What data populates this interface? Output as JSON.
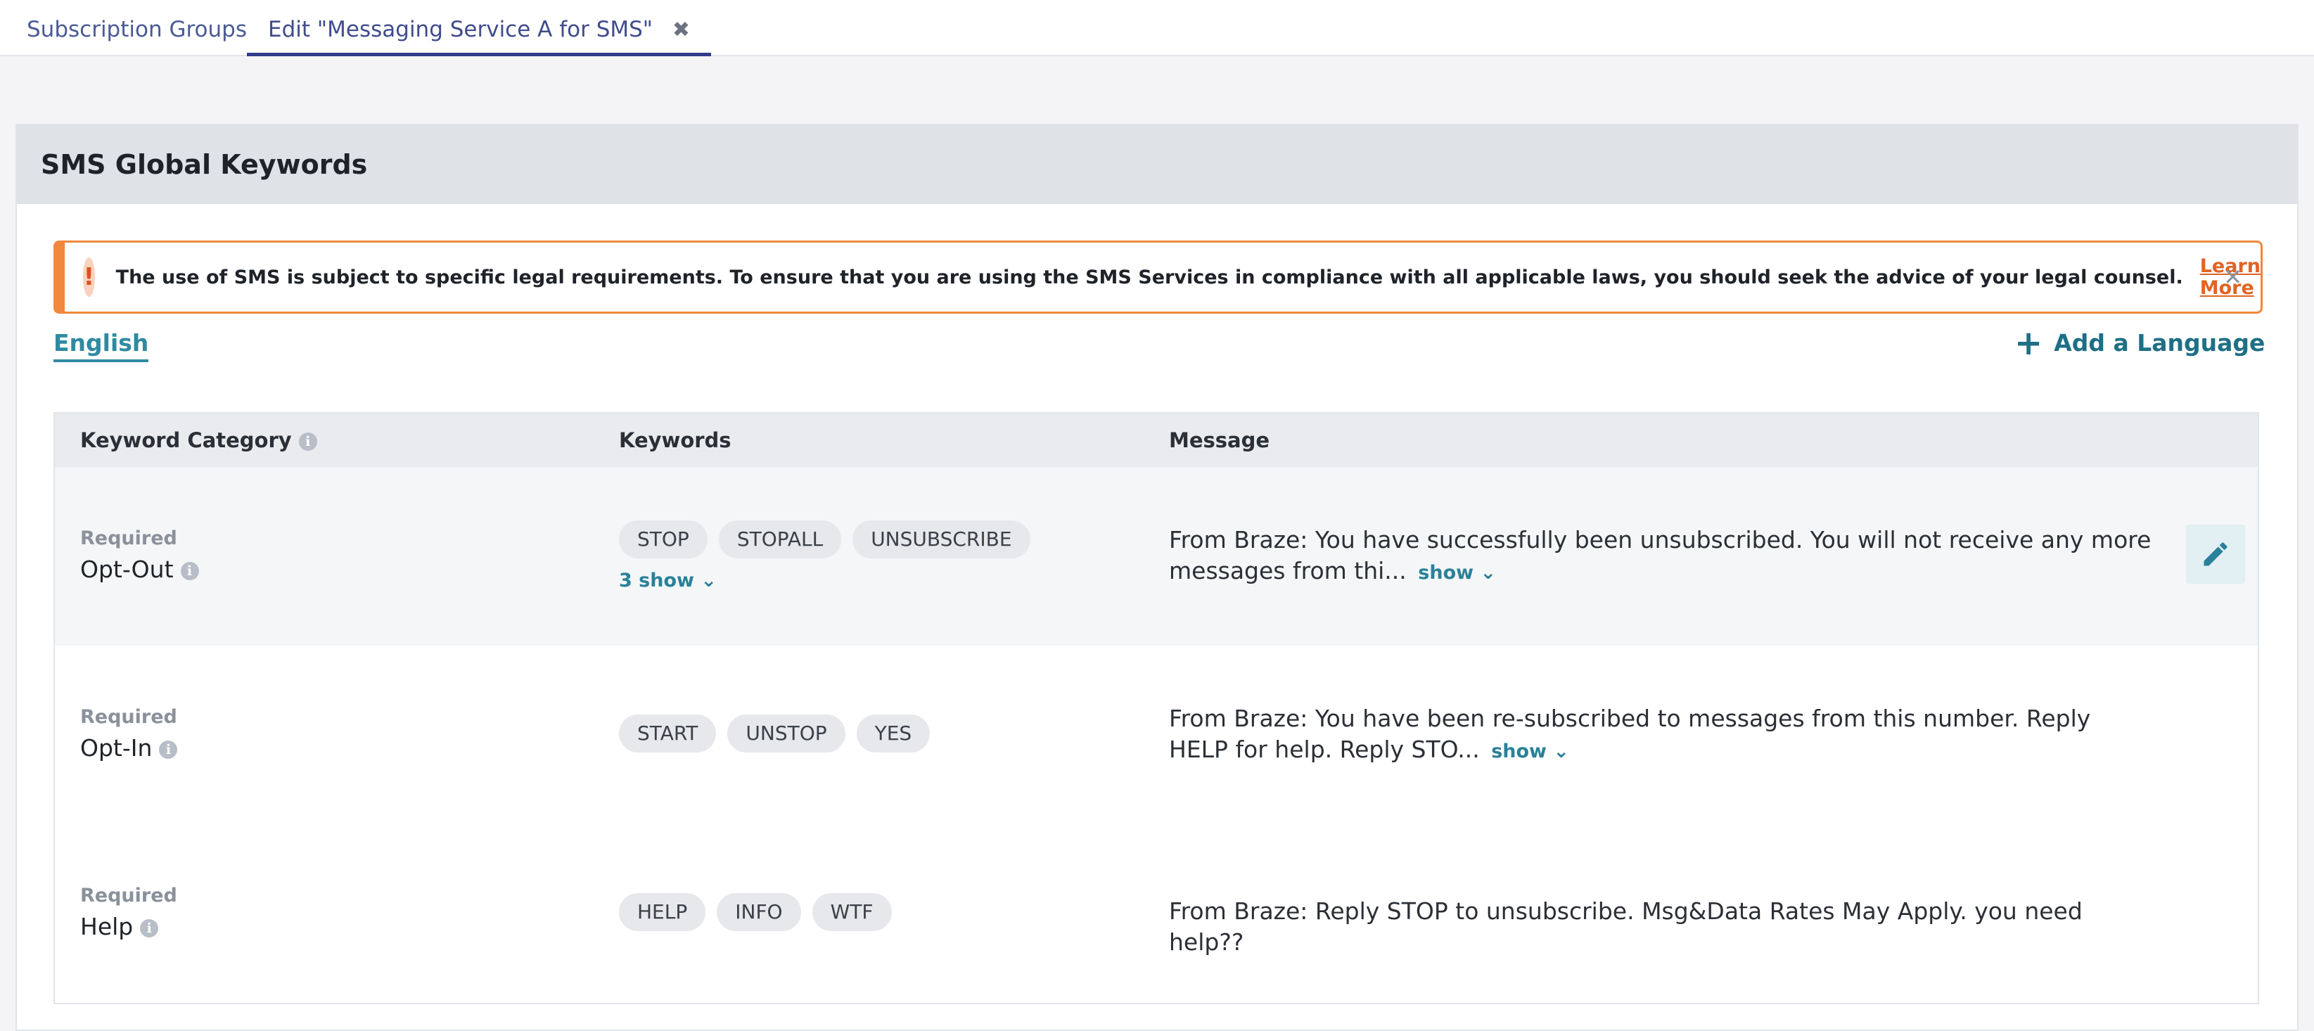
{
  "tabs": [
    {
      "label": "Subscription Groups"
    },
    {
      "label": "Edit \"Messaging Service A for SMS\""
    }
  ],
  "card": {
    "title": "SMS Global Keywords"
  },
  "alert": {
    "text": "The use of SMS is subject to specific legal requirements. To ensure that you are using the SMS Services in compliance with all applicable laws, you should seek the advice of your legal counsel.",
    "link": "Learn More",
    "icon": "!",
    "close": "✕"
  },
  "language_tab": "English",
  "add_language": "Add a Language",
  "table": {
    "headers": [
      "Keyword Category",
      "Keywords",
      "Message"
    ],
    "rows": [
      {
        "required": "Required",
        "category": "Opt-Out",
        "keywords": [
          "STOP",
          "STOPALL",
          "UNSUBSCRIBE"
        ],
        "more": "3 show",
        "message": "From Braze: You have successfully been unsubscribed. You will not receive any more messages from thi...",
        "show": "show"
      },
      {
        "required": "Required",
        "category": "Opt-In",
        "keywords": [
          "START",
          "UNSTOP",
          "YES"
        ],
        "message": "From Braze: You have been re-subscribed to messages from this number. Reply HELP for help. Reply STO...",
        "show": "show"
      },
      {
        "required": "Required",
        "category": "Help",
        "keywords": [
          "HELP",
          "INFO",
          "WTF"
        ],
        "message": "From Braze: Reply STOP to unsubscribe. Msg&Data Rates May Apply. you need help??"
      }
    ]
  },
  "colors": {
    "accent": "#2f8aa0",
    "alert": "#f0883e",
    "tab_active": "#303b8a"
  }
}
